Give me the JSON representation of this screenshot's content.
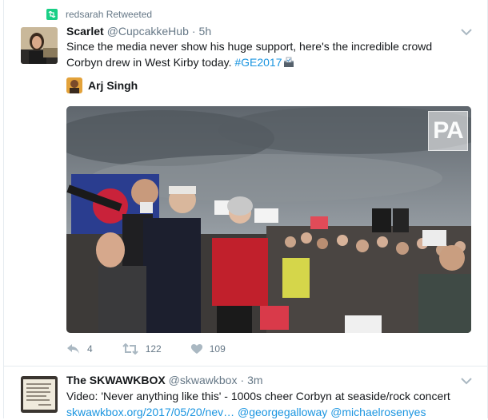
{
  "retweet_context": {
    "icon": "retweet-icon",
    "text": "redsarah Retweeted"
  },
  "tweet1": {
    "display_name": "Scarlet",
    "handle": "@CupcakkeHub",
    "separator": "·",
    "time": "5h",
    "text_line1": "Since the media never show his huge support, here's the incredible crowd",
    "text_line2_prefix": "Corbyn drew in West Kirby today. ",
    "hashtag": "#GE2017",
    "media_author": "Arj Singh",
    "media_watermark": "PA",
    "actions": {
      "reply_count": "4",
      "retweet_count": "122",
      "like_count": "109"
    },
    "colors": {
      "retweet_green": "#19cf86",
      "link_blue": "#1b95e0",
      "muted": "#657786"
    }
  },
  "tweet2": {
    "display_name": "The SKWAWKBOX",
    "handle": "@skwawkbox",
    "separator": "·",
    "time": "3m",
    "text_line1": "Video: 'Never anything like this' - 1000s cheer Corbyn at seaside/rock concert",
    "link": "skwawkbox.org/2017/05/20/nev…",
    "mention1": "@georgegalloway",
    "mention2": "@michaelrosenyes"
  }
}
